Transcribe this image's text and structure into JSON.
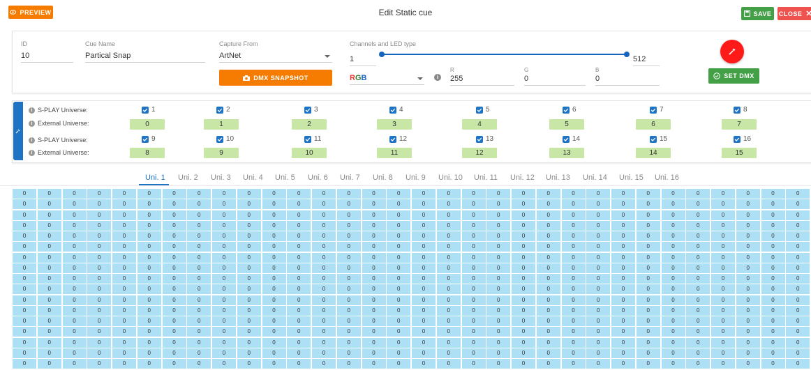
{
  "header": {
    "preview_label": "PREVIEW",
    "title": "Edit Static cue",
    "save_label": "SAVE",
    "close_label": "CLOSE"
  },
  "form": {
    "id_label": "ID",
    "id_value": "10",
    "cue_name_label": "Cue Name",
    "cue_name_value": "Partical Snap",
    "capture_label": "Capture From",
    "capture_value": "ArtNet",
    "snapshot_label": "DMX SNAPSHOT",
    "channels_label": "Channels and LED type",
    "channel_start": "1",
    "channel_end": "512",
    "led_type": "RGB",
    "r_label": "R",
    "r_value": "255",
    "g_label": "G",
    "g_value": "0",
    "b_label": "B",
    "b_value": "0",
    "set_dmx_label": "SET DMX",
    "color_swatch": "#ff1a1a"
  },
  "universes": {
    "splay_label": "S-PLAY Universe:",
    "external_label": "External Universe:",
    "row1": [
      {
        "splay": "1",
        "ext": "0"
      },
      {
        "splay": "2",
        "ext": "1"
      },
      {
        "splay": "3",
        "ext": "2"
      },
      {
        "splay": "4",
        "ext": "3"
      },
      {
        "splay": "5",
        "ext": "4"
      },
      {
        "splay": "6",
        "ext": "5"
      },
      {
        "splay": "7",
        "ext": "6"
      },
      {
        "splay": "8",
        "ext": "7"
      }
    ],
    "row2": [
      {
        "splay": "9",
        "ext": "8"
      },
      {
        "splay": "10",
        "ext": "9"
      },
      {
        "splay": "11",
        "ext": "10"
      },
      {
        "splay": "12",
        "ext": "11"
      },
      {
        "splay": "13",
        "ext": "12"
      },
      {
        "splay": "14",
        "ext": "13"
      },
      {
        "splay": "15",
        "ext": "14"
      },
      {
        "splay": "16",
        "ext": "15"
      }
    ]
  },
  "tabs": [
    "Uni. 1",
    "Uni. 2",
    "Uni. 3",
    "Uni. 4",
    "Uni. 5",
    "Uni. 6",
    "Uni. 7",
    "Uni. 8",
    "Uni. 9",
    "Uni. 10",
    "Uni. 11",
    "Uni. 12",
    "Uni. 13",
    "Uni. 14",
    "Uni. 15",
    "Uni. 16"
  ],
  "active_tab": "Uni. 1",
  "grid": {
    "rows": 17,
    "cols": 32,
    "default_value": "0"
  },
  "colors": {
    "orange": "#f57c00",
    "green": "#43a047",
    "red": "#ef5350",
    "blue": "#1e73c4",
    "cell_bg": "#aee0f5",
    "ext_bg": "#c8e6a6"
  }
}
